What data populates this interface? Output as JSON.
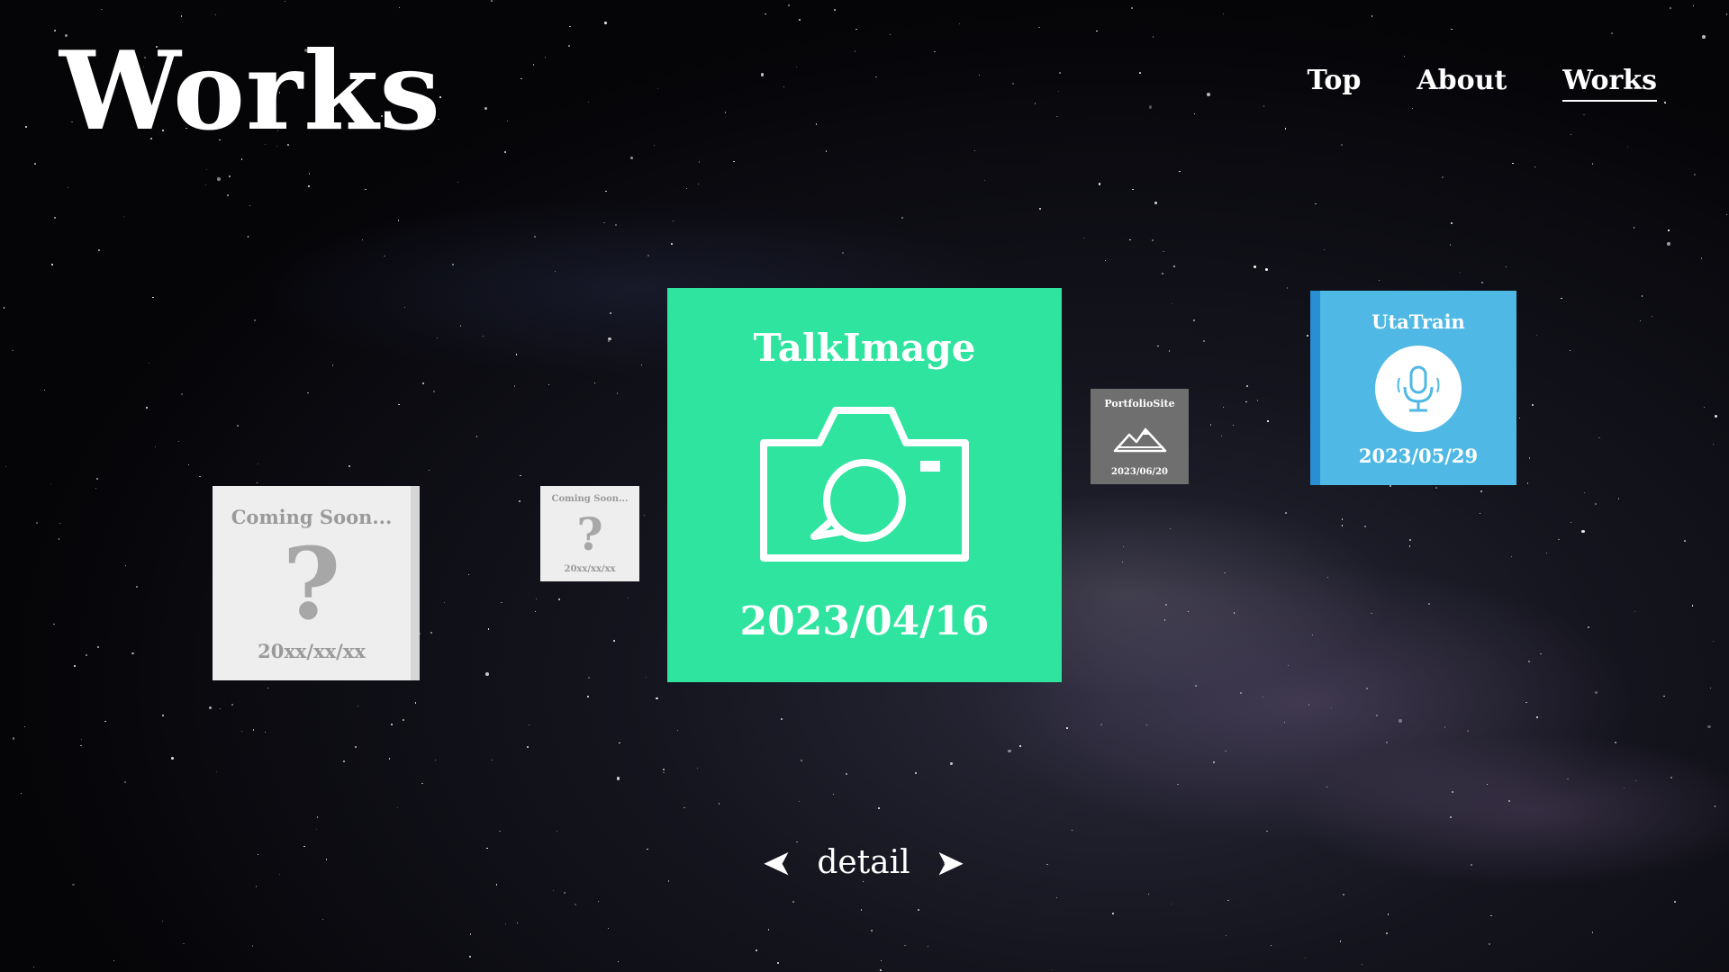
{
  "header": {
    "title": "Works"
  },
  "nav": {
    "items": [
      "Top",
      "About",
      "Works"
    ],
    "active": "Works"
  },
  "works": {
    "coming_large": {
      "title": "Coming Soon...",
      "date": "20xx/xx/xx",
      "icon": "question-mark-icon",
      "glyph": "?"
    },
    "coming_small": {
      "title": "Coming Soon...",
      "date": "20xx/xx/xx",
      "icon": "question-mark-icon",
      "glyph": "?"
    },
    "talkimage": {
      "title": "TalkImage",
      "date": "2023/04/16",
      "icon": "camera-chat-icon",
      "color": "#2ee49f"
    },
    "portfolio": {
      "title": "PortfolioSite",
      "date": "2023/06/20",
      "icon": "mountain-icon",
      "color": "#6f6f6f"
    },
    "utatrain": {
      "title": "UtaTrain",
      "date": "2023/05/29",
      "icon": "microphone-icon",
      "color": "#4fb8e4"
    }
  },
  "controls": {
    "prev_icon": "chevron-left-icon",
    "next_icon": "chevron-right-icon",
    "detail_label": "detail"
  }
}
